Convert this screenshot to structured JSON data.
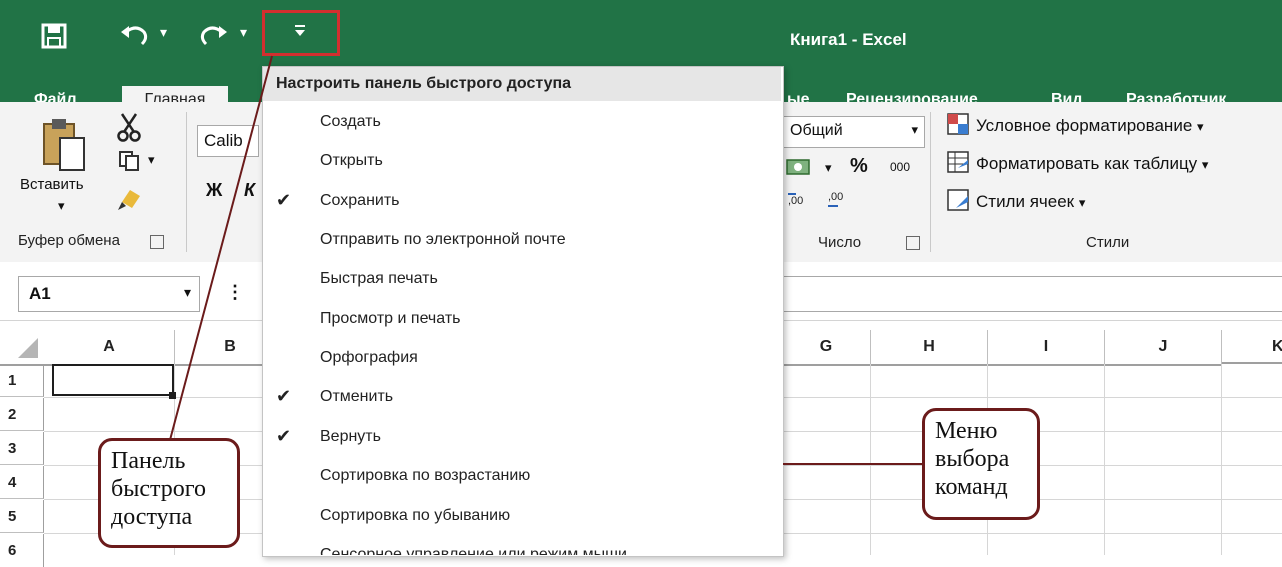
{
  "title_bar": {
    "title": "Книга1 - Excel"
  },
  "quick_access": {
    "save_icon": "save-icon",
    "undo_icon": "undo-icon",
    "redo_icon": "redo-icon",
    "customize_icon": "customize-qat-icon"
  },
  "tabs": [
    {
      "label": "Файл"
    },
    {
      "label": "Главная"
    },
    {
      "label": "ые"
    },
    {
      "label": "Рецензирование"
    },
    {
      "label": "Вид"
    },
    {
      "label": "Разработчик"
    }
  ],
  "ribbon": {
    "paste_label": "Вставить",
    "clipboard_group": "Буфер обмена",
    "font_name": "Calib",
    "bold_label": "Ж",
    "italic_label": "К",
    "number_format": "Общий",
    "percent_label": "%",
    "thousands_label": "000",
    "number_group": "Число",
    "styles_group": "Стили",
    "conditional_formatting": "Условное форматирование",
    "format_as_table": "Форматировать как таблицу",
    "cell_styles": "Стили ячеек",
    "dropdown_marker": "▾"
  },
  "formula_bar": {
    "name_box": "A1",
    "separator": "⋮"
  },
  "grid": {
    "columns_left": [
      "A",
      "B"
    ],
    "columns_right": [
      "G",
      "H",
      "I",
      "J",
      "K"
    ],
    "rows": [
      "1",
      "2",
      "3",
      "4",
      "5",
      "6"
    ]
  },
  "menu": {
    "header": "Настроить панель быстрого доступа",
    "items": [
      {
        "label": "Создать",
        "checked": false
      },
      {
        "label": "Открыть",
        "checked": false
      },
      {
        "label": "Сохранить",
        "checked": true
      },
      {
        "label": "Отправить по электронной почте",
        "checked": false
      },
      {
        "label": "Быстрая печать",
        "checked": false
      },
      {
        "label": "Просмотр и печать",
        "checked": false
      },
      {
        "label": "Орфография",
        "checked": false
      },
      {
        "label": "Отменить",
        "checked": true
      },
      {
        "label": "Вернуть",
        "checked": true
      },
      {
        "label": "Сортировка по возрастанию",
        "checked": false
      },
      {
        "label": "Сортировка по убыванию",
        "checked": false
      },
      {
        "label": "Сенсорное управление или режим мыши",
        "checked": false
      }
    ],
    "check_glyph": "✔"
  },
  "callouts": {
    "qat_line1": "Панель",
    "qat_line2": "быстрого",
    "qat_line3": "доступа",
    "menu_line1": "Меню",
    "menu_line2": "выбора",
    "menu_line3": "команд"
  },
  "colors": {
    "excel_green": "#217346",
    "callout_border": "#6b1b1b",
    "highlight_red": "#d32f2f"
  }
}
